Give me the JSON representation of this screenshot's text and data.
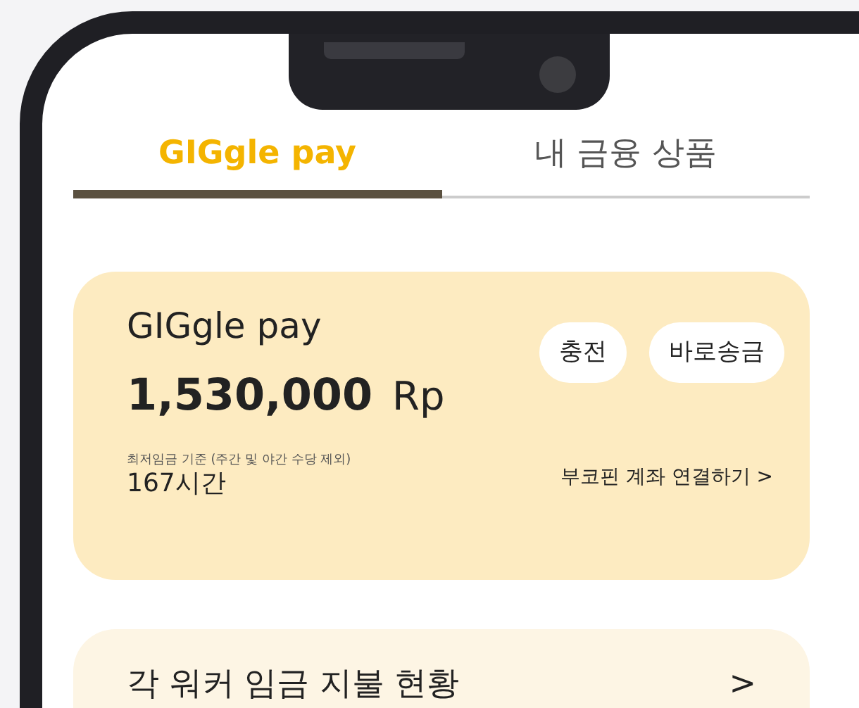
{
  "tabs": [
    {
      "label": "GIGgle pay",
      "selected": true
    },
    {
      "label": "내 금융 상품",
      "selected": false
    }
  ],
  "pay_card": {
    "title": "GIGgle pay",
    "amount": "1,530,000",
    "currency": "Rp",
    "buttons": [
      "충전",
      "바로송금"
    ],
    "note": "최저임금 기준 (주간 및 야간 수당 제외)",
    "hours": "167시간",
    "link": "부코핀 계좌 연결하기 >"
  },
  "section": {
    "title": "각 워커 임금 지불 현황",
    "chevron": ">"
  }
}
